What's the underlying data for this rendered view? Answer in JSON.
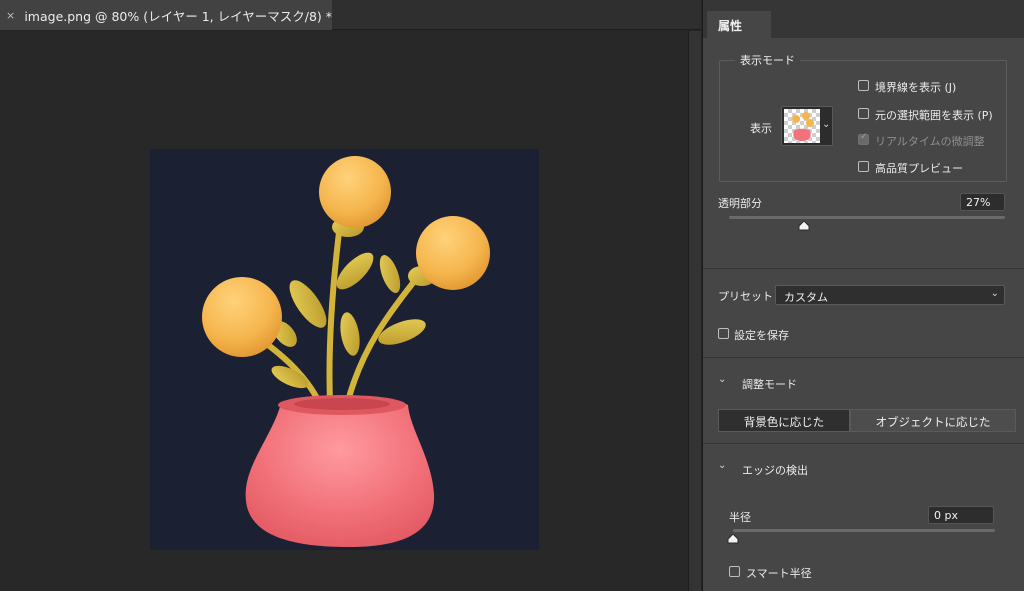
{
  "document": {
    "close_glyph": "×",
    "tab_title": "image.png @ 80% (レイヤー 1, レイヤーマスク/8) *"
  },
  "canvas": {
    "background_color": "#1b2133",
    "pot_color": "#f2727a",
    "flower_color": "#f5b54d",
    "stem_color": "#d3b43a"
  },
  "properties": {
    "tab_label": "属性",
    "view_mode": {
      "legend": "表示モード",
      "view_label": "表示",
      "dropdown_chevron": "⌄",
      "options": [
        {
          "label": "境界線を表示 (J)",
          "checked": false,
          "disabled": false
        },
        {
          "label": "元の選択範囲を表示 (P)",
          "checked": false,
          "disabled": false
        },
        {
          "label": "リアルタイムの微調整",
          "checked": true,
          "disabled": true
        },
        {
          "label": "高品質プレビュー",
          "checked": false,
          "disabled": false
        }
      ]
    },
    "transparency": {
      "label": "透明部分",
      "value": "27%",
      "level": 0.27
    },
    "preset": {
      "label": "プリセット",
      "value": "カスタム",
      "chevron": "⌄"
    },
    "save_settings": {
      "label": "設定を保存",
      "checked": false
    },
    "refine_mode": {
      "chevron": "⌄",
      "title": "調整モード",
      "segments": [
        "背景色に応じた",
        "オブジェクトに応じた"
      ],
      "active_index": 0
    },
    "edge_detection": {
      "chevron": "⌄",
      "title": "エッジの検出",
      "radius_label": "半径",
      "radius_value": "0 px",
      "radius_level": 0,
      "smart_radius_label": "スマート半径",
      "smart_radius_checked": false
    }
  }
}
